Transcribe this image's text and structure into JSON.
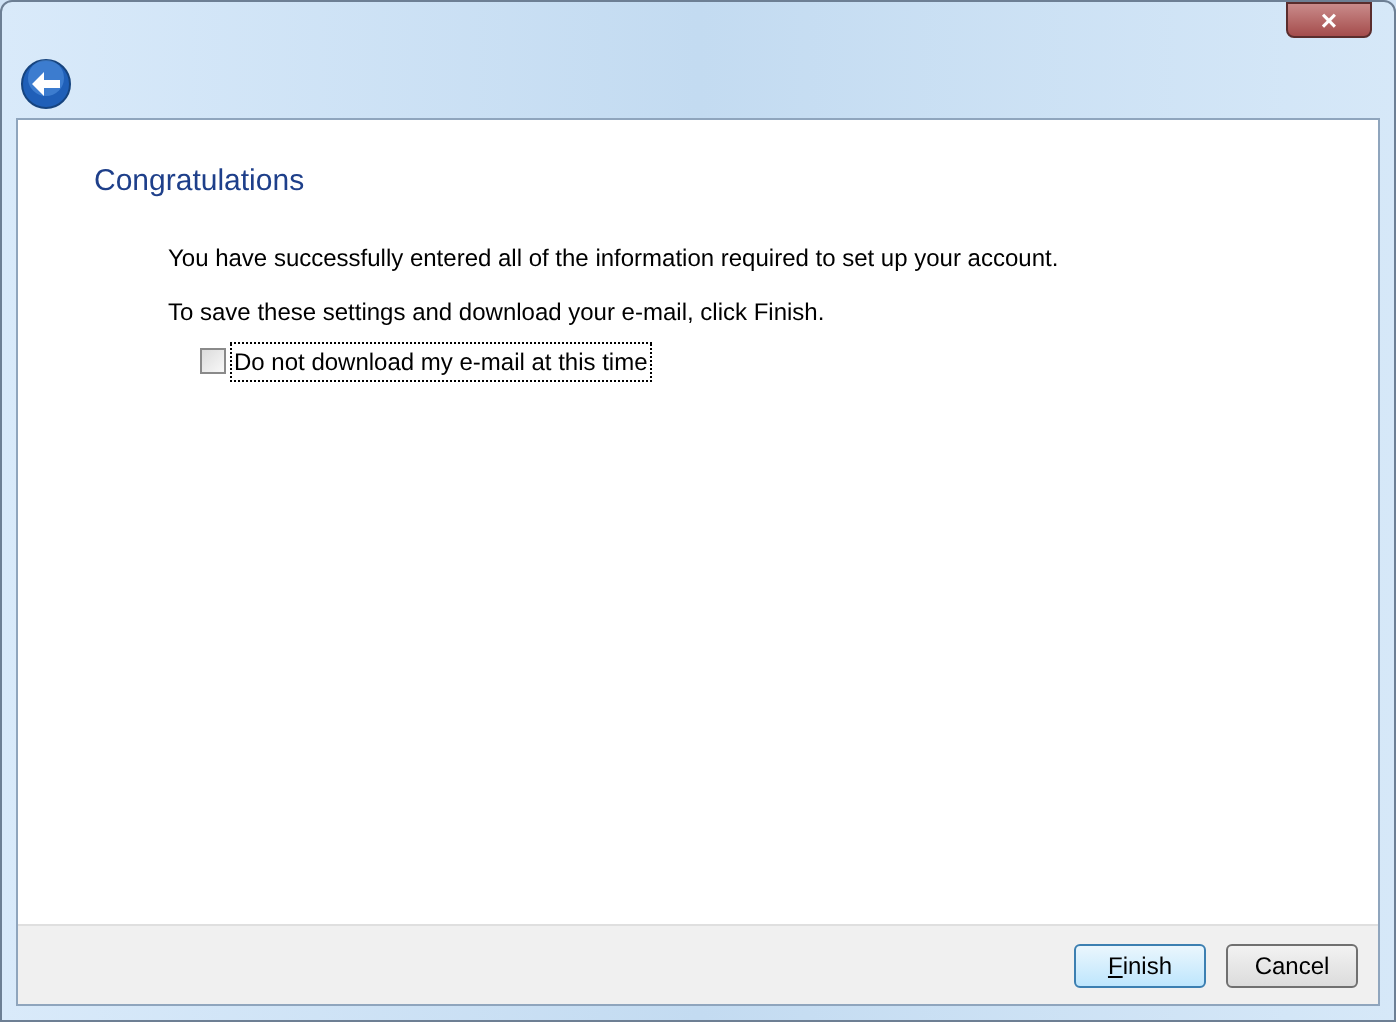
{
  "window": {
    "close": "×"
  },
  "heading": "Congratulations",
  "paragraphs": [
    "You have successfully entered all of the information required to set up your account.",
    "To save these settings and download your e-mail, click Finish."
  ],
  "checkbox": {
    "label": "Do not download my e-mail at this time",
    "checked": false,
    "focused": true
  },
  "buttons": [
    {
      "label": "Finish",
      "first_letter_underlined": true,
      "default": true
    },
    {
      "label": "Cancel",
      "default": false
    }
  ]
}
